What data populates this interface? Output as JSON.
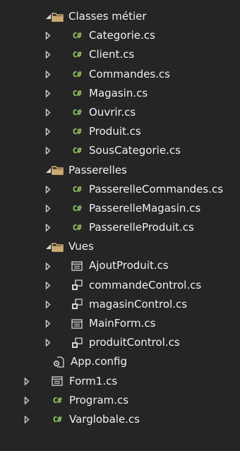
{
  "colors": {
    "background": "#252526",
    "text": "#f1f1f1",
    "arrow": "#d6d6d6",
    "folder": "#dcb67a",
    "csharp": "#9bd86b",
    "form_icon": "#d6d6d6",
    "user_control_icon": "#d6d6d6"
  },
  "csharp_glyph": "C#",
  "tree": [
    {
      "label": "Classes métier",
      "level": 1,
      "state": "expanded",
      "icon": "folder-icon"
    },
    {
      "label": "Categorie.cs",
      "level": 2,
      "state": "collapsed",
      "icon": "csharp-file-icon"
    },
    {
      "label": "Client.cs",
      "level": 2,
      "state": "collapsed",
      "icon": "csharp-file-icon"
    },
    {
      "label": "Commandes.cs",
      "level": 2,
      "state": "collapsed",
      "icon": "csharp-file-icon"
    },
    {
      "label": "Magasin.cs",
      "level": 2,
      "state": "collapsed",
      "icon": "csharp-file-icon"
    },
    {
      "label": "Ouvrir.cs",
      "level": 2,
      "state": "collapsed",
      "icon": "csharp-file-icon"
    },
    {
      "label": "Produit.cs",
      "level": 2,
      "state": "collapsed",
      "icon": "csharp-file-icon"
    },
    {
      "label": "SousCategorie.cs",
      "level": 2,
      "state": "collapsed",
      "icon": "csharp-file-icon"
    },
    {
      "label": "Passerelles",
      "level": 1,
      "state": "expanded",
      "icon": "folder-icon"
    },
    {
      "label": "PasserelleCommandes.cs",
      "level": 2,
      "state": "collapsed",
      "icon": "csharp-file-icon"
    },
    {
      "label": "PasserelleMagasin.cs",
      "level": 2,
      "state": "collapsed",
      "icon": "csharp-file-icon"
    },
    {
      "label": "PasserelleProduit.cs",
      "level": 2,
      "state": "collapsed",
      "icon": "csharp-file-icon"
    },
    {
      "label": "Vues",
      "level": 1,
      "state": "expanded",
      "icon": "folder-icon"
    },
    {
      "label": "AjoutProduit.cs",
      "level": 2,
      "state": "collapsed",
      "icon": "form-icon"
    },
    {
      "label": "commandeControl.cs",
      "level": 2,
      "state": "collapsed",
      "icon": "user-control-icon"
    },
    {
      "label": "magasinControl.cs",
      "level": 2,
      "state": "collapsed",
      "icon": "user-control-icon"
    },
    {
      "label": "MainForm.cs",
      "level": 2,
      "state": "collapsed",
      "icon": "form-icon"
    },
    {
      "label": "produitControl.cs",
      "level": 2,
      "state": "collapsed",
      "icon": "user-control-icon"
    },
    {
      "label": "App.config",
      "level": 1,
      "state": "none",
      "icon": "config-file-icon"
    },
    {
      "label": "Form1.cs",
      "level": 0,
      "state": "collapsed",
      "icon": "form-icon"
    },
    {
      "label": "Program.cs",
      "level": 0,
      "state": "collapsed",
      "icon": "csharp-file-icon"
    },
    {
      "label": "Varglobale.cs",
      "level": 0,
      "state": "collapsed",
      "icon": "csharp-file-icon"
    }
  ]
}
